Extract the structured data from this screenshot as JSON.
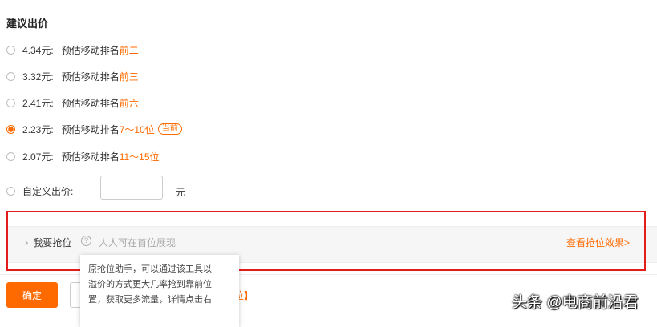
{
  "section_title": "建议出价",
  "options": [
    {
      "price": "4.34元:",
      "desc": "预估移动排名",
      "rank": "前二",
      "badge": "",
      "checked": false
    },
    {
      "price": "3.32元:",
      "desc": "预估移动排名",
      "rank": "前三",
      "badge": "",
      "checked": false
    },
    {
      "price": "2.41元:",
      "desc": "预估移动排名",
      "rank": "前六",
      "badge": "",
      "checked": false
    },
    {
      "price": "2.23元:",
      "desc": "预估移动排名",
      "rank": "7～10位",
      "badge": "当前",
      "checked": true
    },
    {
      "price": "2.07元:",
      "desc": "预估移动排名",
      "rank": "11～15位",
      "badge": "",
      "checked": false
    }
  ],
  "custom_bid": {
    "label": "自定义出价:",
    "value": "",
    "unit": "元"
  },
  "grab": {
    "label": "我要抢位",
    "help": "?",
    "hint": "人人可在首位展现",
    "link": "查看抢位效果>"
  },
  "tooltip": {
    "lines": [
      "原抢位助手，可以通过该工具以",
      "溢价的方式更大几率抢到靠前位",
      "置，获取更多流量，详情点击右"
    ]
  },
  "footer": {
    "confirm": "确定",
    "partial_text": "位】"
  },
  "watermark": "头条 @电商前沿君",
  "colors": {
    "accent": "#ff6a00",
    "highlight_box": "#e31c1c"
  }
}
